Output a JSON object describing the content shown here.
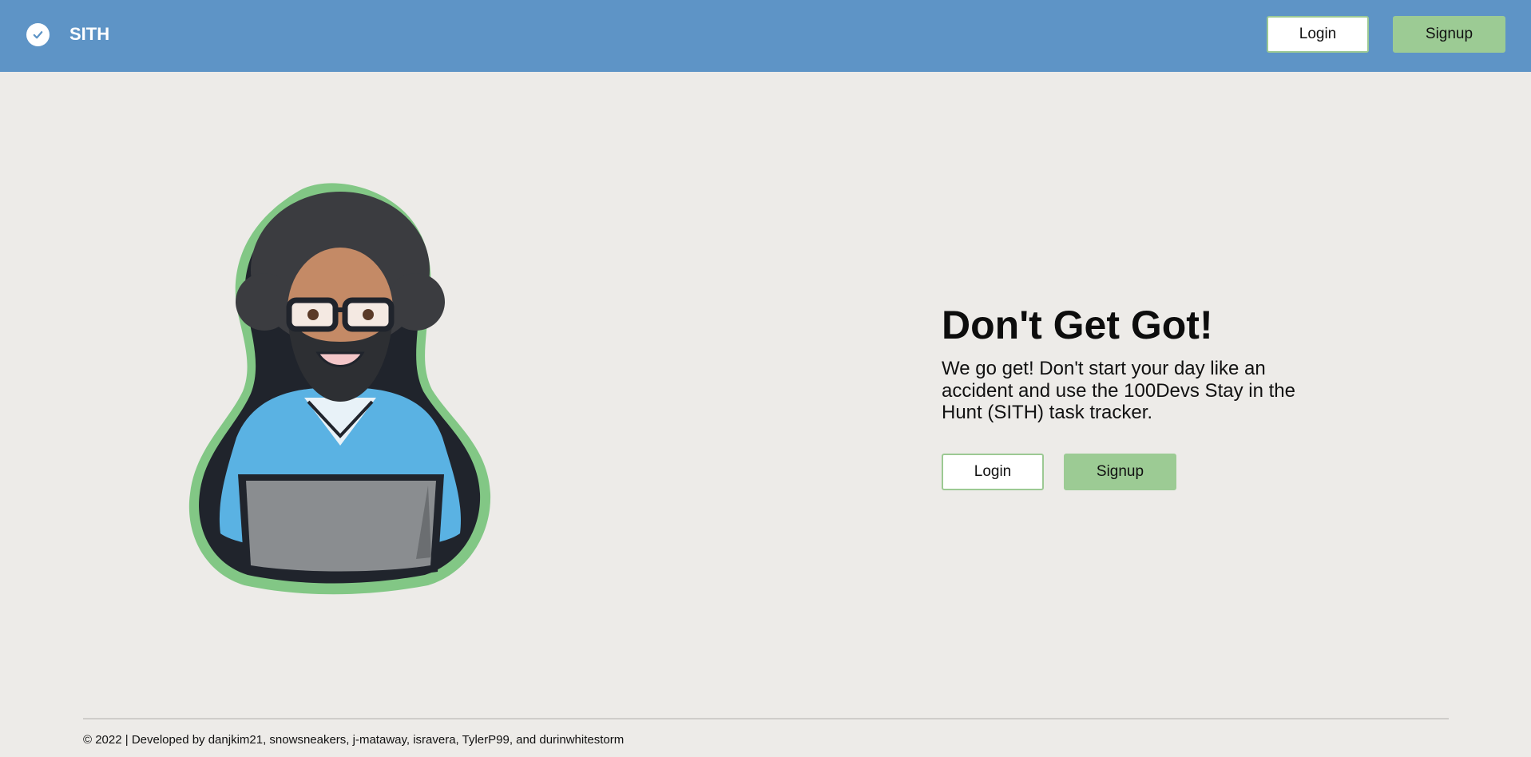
{
  "header": {
    "brand_icon": "check-circle-icon",
    "brand_name": "SITH",
    "login_label": "Login",
    "signup_label": "Signup"
  },
  "hero": {
    "illustration": "developer-mascot-illustration",
    "title": "Don't Get Got!",
    "description": "We go get! Don't start your day like an accident and use the 100Devs Stay in the Hunt (SITH) task tracker.",
    "login_label": "Login",
    "signup_label": "Signup"
  },
  "footer": {
    "text": "© 2022 | Developed by danjkim21, snowsneakers, j-mataway, isravera, TylerP99, and durinwhitestorm"
  },
  "colors": {
    "header_bg": "#5e94c6",
    "page_bg": "#edebe8",
    "accent_green": "#9ccb94",
    "outline_green": "#9cc993"
  }
}
